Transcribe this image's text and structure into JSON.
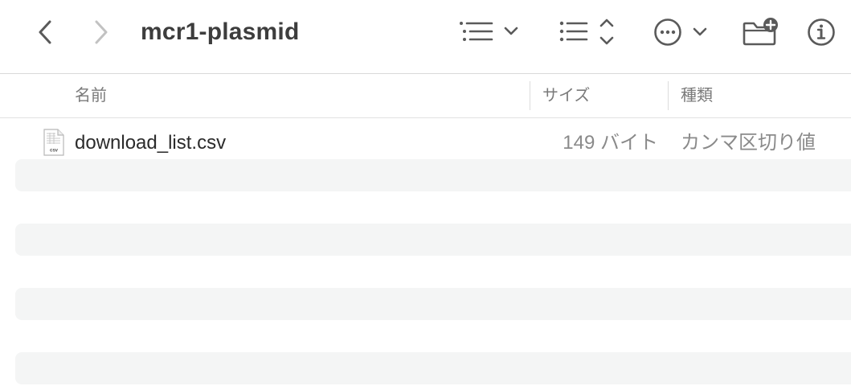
{
  "toolbar": {
    "back_icon": "chevron-left-icon",
    "forward_icon": "chevron-right-icon",
    "title": "mcr1-plasmid",
    "view_options_icon": "list-view-icon",
    "sort_icon": "sort-list-icon",
    "more_icon": "ellipsis-circle-icon",
    "new_folder_icon": "folder-add-icon",
    "info_icon": "info-circle-icon"
  },
  "columns": {
    "name": "名前",
    "size": "サイズ",
    "kind": "種類"
  },
  "files": [
    {
      "name": "download_list.csv",
      "size": "149 バイト",
      "kind": "カンマ区切り値",
      "icon": "csv-file-icon",
      "icon_label": "csv"
    }
  ]
}
